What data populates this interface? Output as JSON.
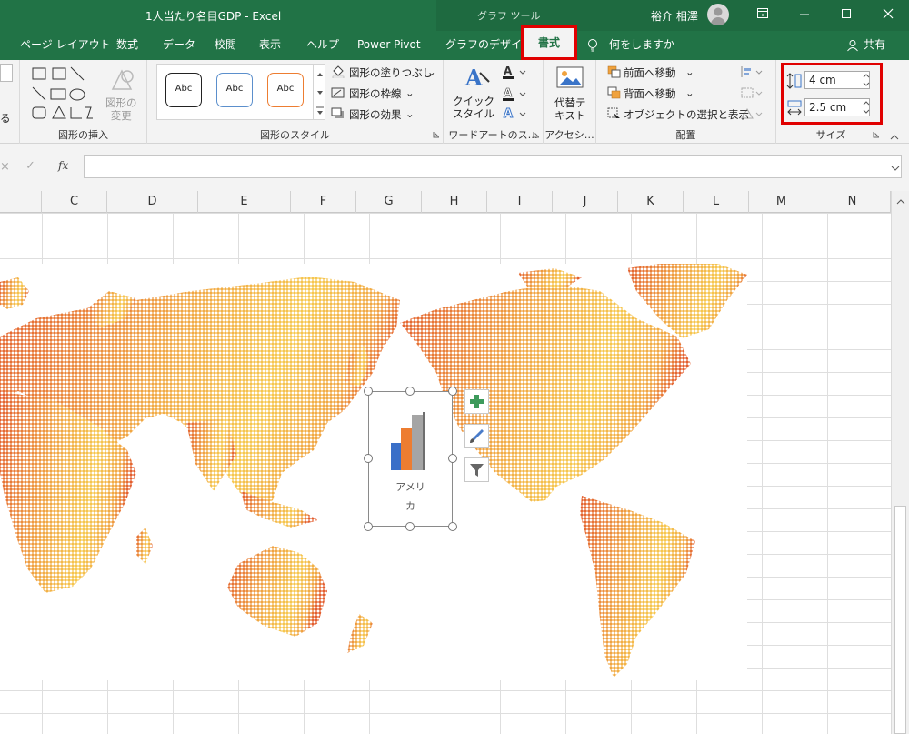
{
  "app": {
    "title": "1人当たり名目GDP  -  Excel",
    "context_tab_group": "グラフ ツール",
    "user_name": "裕介 相澤",
    "share_label": "共有"
  },
  "tabs": [
    {
      "label": "ページ レイアウト"
    },
    {
      "label": "数式"
    },
    {
      "label": "データ"
    },
    {
      "label": "校閲"
    },
    {
      "label": "表示"
    },
    {
      "label": "ヘルプ"
    },
    {
      "label": "Power Pivot"
    },
    {
      "label": "グラフのデザイン"
    },
    {
      "label": "書式"
    }
  ],
  "tell_me": "何をしますか",
  "ribbon": {
    "insert_shapes": {
      "change_shape": "図形の\n変更",
      "label": "図形の挿入"
    },
    "shape_styles": {
      "thumbnail": "Abc",
      "fill": "図形の塗りつぶし",
      "outline": "図形の枠線",
      "effects": "図形の効果",
      "label": "図形のスタイル"
    },
    "wordart": {
      "quick_styles": "クイック\nスタイル",
      "label": "ワードアートのス…"
    },
    "accessibility": {
      "alt_text": "代替テ\nキスト",
      "label": "アクセシ…"
    },
    "arrange": {
      "bring_forward": "前面へ移動",
      "send_backward": "背面へ移動",
      "selection_pane": "オブジェクトの選択と表示",
      "label": "配置"
    },
    "size": {
      "height": "4 cm",
      "width": "2.5 cm",
      "label": "サイズ"
    }
  },
  "formula_bar": {
    "fx": "fx",
    "value": ""
  },
  "columns": [
    "C",
    "D",
    "E",
    "F",
    "G",
    "H",
    "I",
    "J",
    "K",
    "L",
    "M",
    "N"
  ],
  "chart": {
    "category_label": "アメリ\nカ"
  },
  "colors": {
    "excel_green": "#217346",
    "highlight_red": "#e00000",
    "map_gradient": [
      "#e25a2a",
      "#f0a23d",
      "#f6c64a"
    ]
  }
}
